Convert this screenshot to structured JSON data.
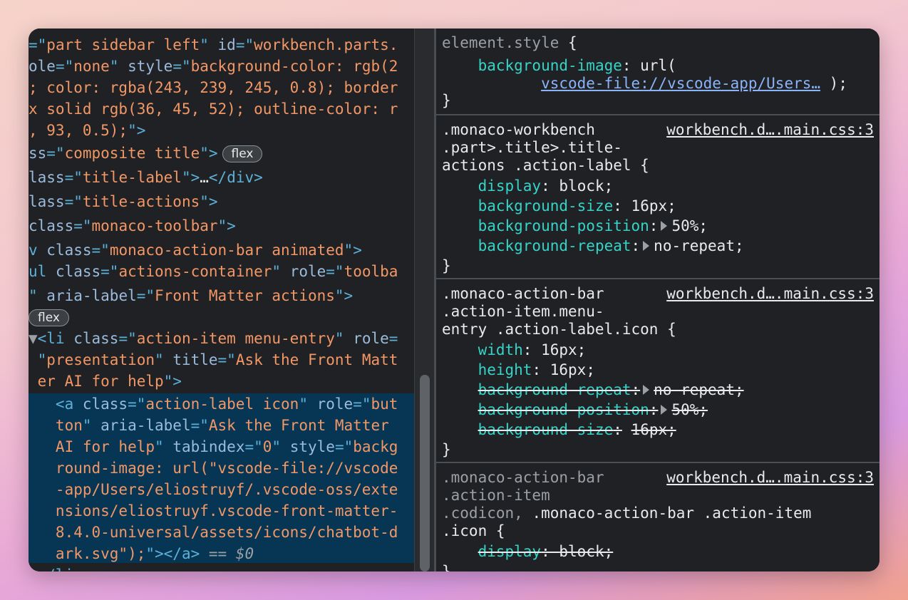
{
  "elements": {
    "lines": [
      {
        "parts": [
          {
            "t": "=\"",
            "c": "t-tag"
          },
          {
            "t": "part sidebar left",
            "c": "t-val"
          },
          {
            "t": "\" ",
            "c": "t-tag"
          },
          {
            "t": "id",
            "c": "t-attr"
          },
          {
            "t": "=\"",
            "c": "t-tag"
          },
          {
            "t": "workbench.parts.",
            "c": "t-val"
          }
        ]
      },
      {
        "parts": [
          {
            "t": "ole",
            "c": "t-attr"
          },
          {
            "t": "=\"",
            "c": "t-tag"
          },
          {
            "t": "none",
            "c": "t-val"
          },
          {
            "t": "\" ",
            "c": "t-tag"
          },
          {
            "t": "style",
            "c": "t-attr"
          },
          {
            "t": "=\"",
            "c": "t-tag"
          },
          {
            "t": "background-color: rgb(2",
            "c": "t-val"
          }
        ]
      },
      {
        "parts": [
          {
            "t": "; color: rgba(243, 239, 245, 0.8); border",
            "c": "t-val"
          }
        ]
      },
      {
        "parts": [
          {
            "t": "x solid rgb(36, 45, 52); outline-color: r",
            "c": "t-val"
          }
        ]
      },
      {
        "parts": [
          {
            "t": ", 93, 0.5);",
            "c": "t-val"
          },
          {
            "t": "\">",
            "c": "t-tag"
          }
        ]
      },
      {
        "parts": [
          {
            "t": "ss",
            "c": "t-attr"
          },
          {
            "t": "=\"",
            "c": "t-tag"
          },
          {
            "t": "composite title",
            "c": "t-val"
          },
          {
            "t": "\">",
            "c": "t-tag"
          }
        ],
        "badge": "flex"
      },
      {
        "parts": [
          {
            "t": "lass",
            "c": "t-attr"
          },
          {
            "t": "=\"",
            "c": "t-tag"
          },
          {
            "t": "title-label",
            "c": "t-val"
          },
          {
            "t": "\">",
            "c": "t-tag"
          },
          {
            "t": "…",
            "c": "t-text"
          },
          {
            "t": "</div>",
            "c": "t-tag"
          }
        ]
      },
      {
        "parts": [
          {
            "t": "lass",
            "c": "t-attr"
          },
          {
            "t": "=\"",
            "c": "t-tag"
          },
          {
            "t": "title-actions",
            "c": "t-val"
          },
          {
            "t": "\">",
            "c": "t-tag"
          }
        ]
      },
      {
        "parts": [
          {
            "t": "class",
            "c": "t-attr"
          },
          {
            "t": "=\"",
            "c": "t-tag"
          },
          {
            "t": "monaco-toolbar",
            "c": "t-val"
          },
          {
            "t": "\">",
            "c": "t-tag"
          }
        ]
      },
      {
        "parts": [
          {
            "t": "v ",
            "c": "t-tag"
          },
          {
            "t": "class",
            "c": "t-attr"
          },
          {
            "t": "=\"",
            "c": "t-tag"
          },
          {
            "t": "monaco-action-bar animated",
            "c": "t-val"
          },
          {
            "t": "\">",
            "c": "t-tag"
          }
        ]
      },
      {
        "parts": [
          {
            "t": "ul ",
            "c": "t-tag"
          },
          {
            "t": "class",
            "c": "t-attr"
          },
          {
            "t": "=\"",
            "c": "t-tag"
          },
          {
            "t": "actions-container",
            "c": "t-val"
          },
          {
            "t": "\" ",
            "c": "t-tag"
          },
          {
            "t": "role",
            "c": "t-attr"
          },
          {
            "t": "=\"",
            "c": "t-tag"
          },
          {
            "t": "toolba",
            "c": "t-val"
          }
        ]
      },
      {
        "parts": [
          {
            "t": "\" ",
            "c": "t-tag"
          },
          {
            "t": "aria-label",
            "c": "t-attr"
          },
          {
            "t": "=\"",
            "c": "t-tag"
          },
          {
            "t": "Front Matter actions",
            "c": "t-val"
          },
          {
            "t": "\">",
            "c": "t-tag"
          }
        ]
      },
      {
        "parts": [],
        "badge": "flex"
      },
      {
        "parts": [
          {
            "t": "▼",
            "c": "t-dim"
          },
          {
            "t": "<li ",
            "c": "t-tag"
          },
          {
            "t": "class",
            "c": "t-attr"
          },
          {
            "t": "=\"",
            "c": "t-tag"
          },
          {
            "t": "action-item menu-entry",
            "c": "t-val"
          },
          {
            "t": "\" ",
            "c": "t-tag"
          },
          {
            "t": "role",
            "c": "t-attr"
          },
          {
            "t": "=",
            "c": "t-tag"
          }
        ]
      },
      {
        "parts": [
          {
            "t": " \"",
            "c": "t-tag"
          },
          {
            "t": "presentation",
            "c": "t-val"
          },
          {
            "t": "\" ",
            "c": "t-tag"
          },
          {
            "t": "title",
            "c": "t-attr"
          },
          {
            "t": "=\"",
            "c": "t-tag"
          },
          {
            "t": "Ask the Front Matt",
            "c": "t-val"
          }
        ]
      },
      {
        "parts": [
          {
            "t": " er AI for help",
            "c": "t-val"
          },
          {
            "t": "\">",
            "c": "t-tag"
          }
        ]
      },
      {
        "parts": [
          {
            "t": "   <a ",
            "c": "t-tag"
          },
          {
            "t": "class",
            "c": "t-attr"
          },
          {
            "t": "=\"",
            "c": "t-tag"
          },
          {
            "t": "action-label icon",
            "c": "t-val"
          },
          {
            "t": "\" ",
            "c": "t-tag"
          },
          {
            "t": "role",
            "c": "t-attr"
          },
          {
            "t": "=\"",
            "c": "t-tag"
          },
          {
            "t": "but",
            "c": "t-val"
          }
        ]
      },
      {
        "parts": [
          {
            "t": "   ton",
            "c": "t-val"
          },
          {
            "t": "\" ",
            "c": "t-tag"
          },
          {
            "t": "aria-label",
            "c": "t-attr"
          },
          {
            "t": "=\"",
            "c": "t-tag"
          },
          {
            "t": "Ask the Front Matter",
            "c": "t-val"
          }
        ]
      },
      {
        "parts": [
          {
            "t": "   AI for help",
            "c": "t-val"
          },
          {
            "t": "\" ",
            "c": "t-tag"
          },
          {
            "t": "tabindex",
            "c": "t-attr"
          },
          {
            "t": "=\"",
            "c": "t-tag"
          },
          {
            "t": "0",
            "c": "t-val"
          },
          {
            "t": "\" ",
            "c": "t-tag"
          },
          {
            "t": "style",
            "c": "t-attr"
          },
          {
            "t": "=\"",
            "c": "t-tag"
          },
          {
            "t": "backg",
            "c": "t-val"
          }
        ]
      },
      {
        "parts": [
          {
            "t": "   round-image: url(\"vscode-file://vscode",
            "c": "t-val"
          }
        ]
      },
      {
        "parts": [
          {
            "t": "   -app/Users/eliostruyf/.vscode-oss/exte",
            "c": "t-val"
          }
        ]
      },
      {
        "parts": [
          {
            "t": "   nsions/eliostruyf.vscode-front-matter-",
            "c": "t-val"
          }
        ]
      },
      {
        "parts": [
          {
            "t": "   8.4.0-universal/assets/icons/chatbot-d",
            "c": "t-val"
          }
        ]
      },
      {
        "parts": [
          {
            "t": "   ark.svg\");",
            "c": "t-val"
          },
          {
            "t": "\"></a>",
            "c": "t-tag"
          },
          {
            "t": " == $0",
            "c": "t-dim"
          }
        ]
      },
      {
        "parts": [
          {
            "t": " </li>",
            "c": "t-tag"
          }
        ]
      }
    ]
  },
  "styles": {
    "element_style": {
      "selector": "element.style",
      "prop": "background-image",
      "url_prefix": "url(",
      "url_link": "vscode-file://vscode-app/Users…",
      "url_suffix": ");"
    },
    "rule1": {
      "selector_lines": [
        ".monaco-workbench",
        ".part>.title>.title-",
        "actions .action-label {"
      ],
      "source": "workbench.d….main.css:3",
      "decls": [
        {
          "prop": "display",
          "value": "block;",
          "arrow": false,
          "strike": false
        },
        {
          "prop": "background-size",
          "value": "16px;",
          "arrow": false,
          "strike": false
        },
        {
          "prop": "background-position",
          "value": "50%;",
          "arrow": true,
          "strike": false
        },
        {
          "prop": "background-repeat",
          "value": "no-repeat;",
          "arrow": true,
          "strike": false
        }
      ]
    },
    "rule2": {
      "selector_lines": [
        ".monaco-action-bar",
        ".action-item.menu-",
        "entry .action-label.icon {"
      ],
      "source": "workbench.d….main.css:3",
      "decls": [
        {
          "prop": "width",
          "value": "16px;",
          "arrow": false,
          "strike": false
        },
        {
          "prop": "height",
          "value": "16px;",
          "arrow": false,
          "strike": false
        },
        {
          "prop": "background-repeat",
          "value": "no-repeat;",
          "arrow": true,
          "strike": true
        },
        {
          "prop": "background-position",
          "value": "50%;",
          "arrow": true,
          "strike": true
        },
        {
          "prop": "background-size",
          "value": "16px;",
          "arrow": false,
          "strike": true
        }
      ]
    },
    "rule3": {
      "selector_grey1": ".monaco-action-bar",
      "selector_grey2": ".action-item",
      "selector_grey3": ".codicon,",
      "selector_white3": " .monaco-action-bar .action-item",
      "selector_white4": ".icon {",
      "source": "workbench.d….main.css:3",
      "decls": [
        {
          "prop": "display",
          "value": "block;",
          "arrow": false,
          "strike": true
        }
      ]
    },
    "close_brace": "}"
  }
}
